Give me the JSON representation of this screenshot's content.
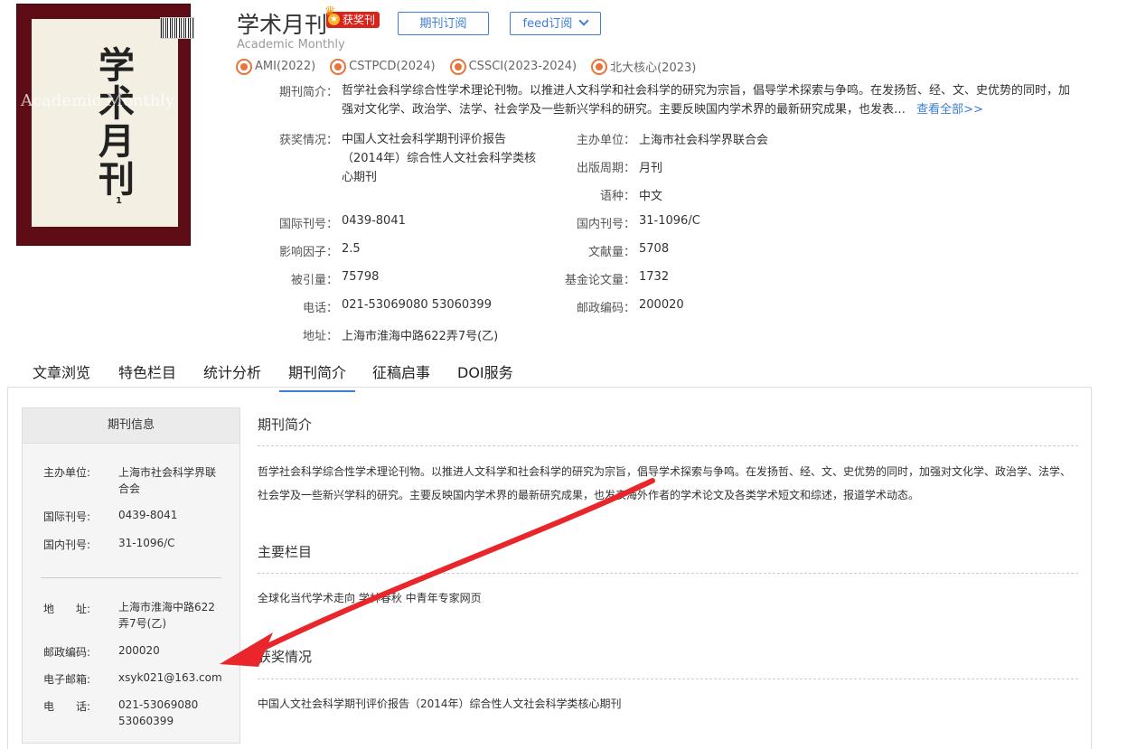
{
  "header": {
    "title": "学术月刊",
    "award_badge": "获奖刊",
    "subscribe_button": "期刊订阅",
    "feed_button": "feed订阅",
    "english_title": "Academic Monthly",
    "cover": {
      "calligraphy": "学术月刊",
      "english": "Academic Monthly",
      "issue": "1"
    },
    "tags": [
      "AMI(2022)",
      "CSTPCD(2024)",
      "CSSCI(2023-2024)",
      "北大核心(2023)"
    ]
  },
  "info": {
    "intro_label": "期刊简介：",
    "intro_text": "哲学社会科学综合性学术理论刊物。以推进人文科学和社会科学的研究为宗旨，倡导学术探索与争鸣。在发扬哲、经、文、史优势的同时，加强对文化学、政治学、法学、社会学及一些新兴学科的研究。主要反映国内学术界的最新研究成果，也发表…",
    "view_all": "查看全部>>",
    "award_label": "获奖情况：",
    "award_value": "中国人文社会科学期刊评价报告（2014年）综合性人文社会科学类核心期刊",
    "sponsor_label": "主办单位：",
    "sponsor_value": "上海市社会科学界联合会",
    "period_label": "出版周期：",
    "period_value": "月刊",
    "lang_label": "语种：",
    "lang_value": "中文",
    "issn_label": "国际刊号：",
    "issn_value": "0439-8041",
    "cn_label": "国内刊号：",
    "cn_value": "31-1096/C",
    "if_label": "影响因子：",
    "if_value": "2.5",
    "docs_label": "文献量：",
    "docs_value": "5708",
    "cited_label": "被引量：",
    "cited_value": "75798",
    "fund_label": "基金论文量：",
    "fund_value": "1732",
    "phone_label": "电话：",
    "phone_value": "021-53069080 53060399",
    "zip_label": "邮政编码：",
    "zip_value": "200020",
    "addr_label": "地址：",
    "addr_value": "上海市淮海中路622弄7号(乙)"
  },
  "tabs": [
    "文章浏览",
    "特色栏目",
    "统计分析",
    "期刊简介",
    "征稿启事",
    "DOI服务"
  ],
  "active_tab": "期刊简介",
  "sidebar": {
    "heading": "期刊信息",
    "sponsor_label": "主办单位:",
    "sponsor_value": "上海市社会科学界联合会",
    "issn_label": "国际刊号:",
    "issn_value": "0439-8041",
    "cn_label": "国内刊号:",
    "cn_value": "31-1096/C",
    "addr_label": "地　　址:",
    "addr_value": "上海市淮海中路622弄7号(乙)",
    "zip_label": "邮政编码:",
    "zip_value": "200020",
    "email_label": "电子邮箱:",
    "email_value": "xsyk021@163.com",
    "phone_label": "电　　话:",
    "phone_value": "021-53069080 53060399"
  },
  "main": {
    "intro_title": "期刊简介",
    "intro_text": "哲学社会科学综合性学术理论刊物。以推进人文科学和社会科学的研究为宗旨，倡导学术探索与争鸣。在发扬哲、经、文、史优势的同时，加强对文化学、政治学、法学、社会学及一些新兴学科的研究。主要反映国内学术界的最新研究成果，也发表海外作者的学术论文及各类学术短文和综述，报道学术动态。",
    "columns_title": "主要栏目",
    "columns_text": "全球化当代学术走向 学林春秋 中青年专家网页",
    "awards_title": "获奖情况",
    "awards_text": "中国人文社会科学期刊评价报告（2014年）综合性人文社会科学类核心期刊"
  },
  "colors": {
    "accent": "#3d7dd6",
    "badge": "#d9241c",
    "tag_icon": "#e8743b",
    "arrow": "#e8262b",
    "cover": "#5e0c16"
  }
}
